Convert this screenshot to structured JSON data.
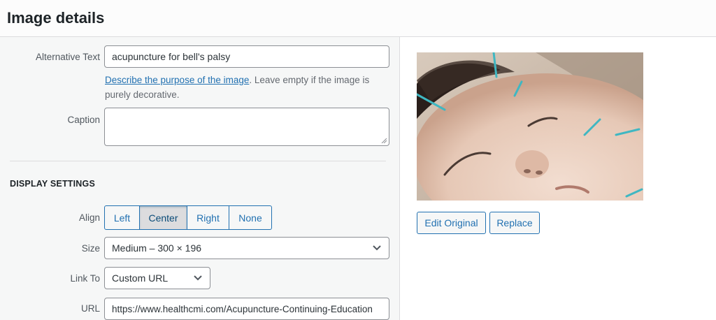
{
  "header": {
    "title": "Image details"
  },
  "alt_text": {
    "label": "Alternative Text",
    "value": "acupuncture for bell's palsy",
    "help_link": "Describe the purpose of the image",
    "help_rest": ". Leave empty if the image is purely decorative."
  },
  "caption": {
    "label": "Caption",
    "value": ""
  },
  "display_settings": {
    "title": "DISPLAY SETTINGS",
    "align": {
      "label": "Align",
      "options": [
        "Left",
        "Center",
        "Right",
        "None"
      ],
      "selected": "Center"
    },
    "size": {
      "label": "Size",
      "value": "Medium – 300 × 196"
    },
    "link_to": {
      "label": "Link To",
      "value": "Custom URL"
    },
    "url": {
      "label": "URL",
      "value": "https://www.healthcmi.com/Acupuncture-Continuing-Education"
    }
  },
  "image_actions": {
    "edit_label": "Edit Original",
    "replace_label": "Replace"
  },
  "colors": {
    "accent": "#2271b1",
    "panel_bg": "#f6f7f7",
    "border": "#8c8f94"
  }
}
